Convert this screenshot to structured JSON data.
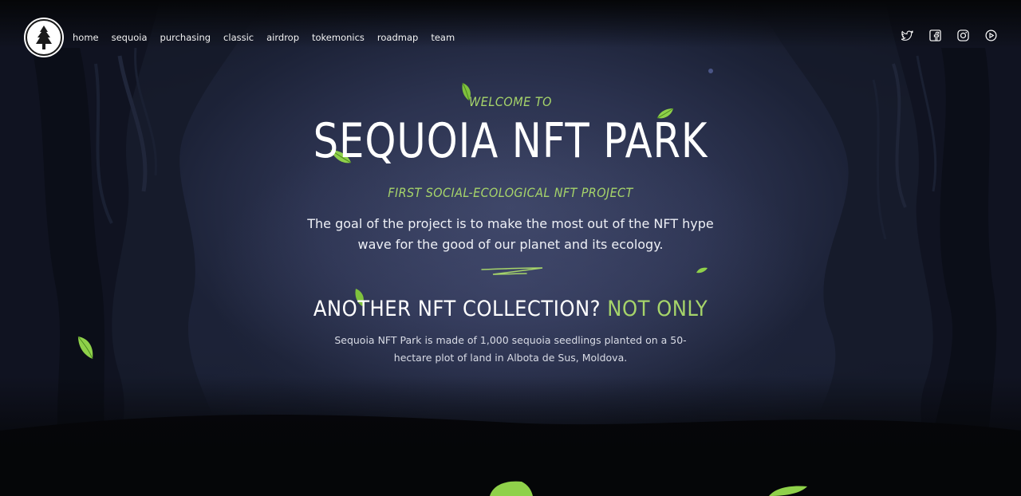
{
  "nav": {
    "logo_name": "sequoia-tree-logo",
    "links": [
      "home",
      "sequoia",
      "purchasing",
      "classic",
      "airdrop",
      "tokemonics",
      "roadmap",
      "team"
    ]
  },
  "socials": [
    "twitter-icon",
    "facebook-icon",
    "instagram-icon",
    "youtube-icon"
  ],
  "hero": {
    "welcome": "WELCOME TO",
    "title": "SEQUOIA NFT PARK",
    "subtitle": "FIRST SOCIAL-ECOLOGICAL NFT PROJECT",
    "goal": "The goal of the project is to make the most out of the NFT hype wave for the good of our planet and its ecology."
  },
  "collection": {
    "title_main": "ANOTHER NFT COLLECTION?",
    "title_accent": "NOT ONLY",
    "description": "Sequoia NFT Park is made of 1,000 sequoia seedlings planted on a 50-hectare plot of land in Albota de Sus, Moldova."
  },
  "colors": {
    "accent": "#a6d46a",
    "background": "#2c3350"
  }
}
